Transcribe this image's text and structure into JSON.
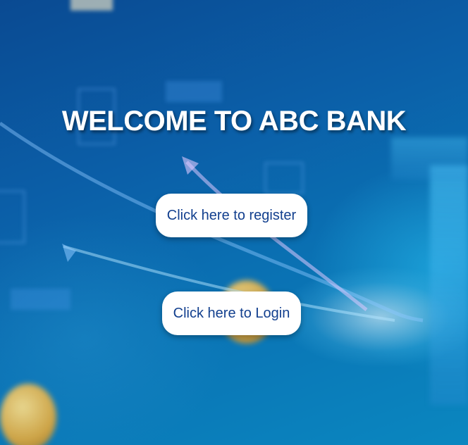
{
  "page": {
    "title": "WELCOME TO ABC BANK"
  },
  "actions": {
    "register_label": "Click here to register",
    "login_label": "Click here to Login"
  },
  "colors": {
    "background_primary": "#0b5fa8",
    "button_background": "#ffffff",
    "button_text": "#123f8e",
    "title_text": "#ffffff"
  }
}
